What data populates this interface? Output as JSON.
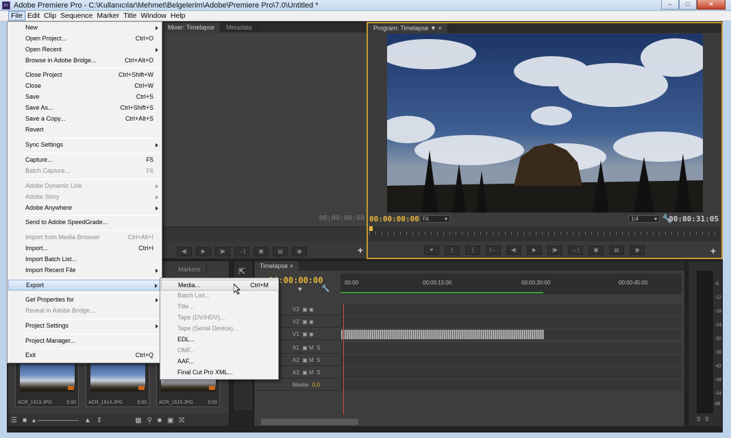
{
  "window": {
    "title": "Adobe Premiere Pro - C:\\Kullanıcılar\\Mehmet\\Belgelerim\\Adobe\\Premiere Pro\\7.0\\Untitled *",
    "app_icon": "Pr"
  },
  "menubar": [
    "File",
    "Edit",
    "Clip",
    "Sequence",
    "Marker",
    "Title",
    "Window",
    "Help"
  ],
  "file_menu": [
    {
      "label": "New",
      "shortcut": "",
      "submenu": true,
      "disabled": false
    },
    {
      "label": "Open Project...",
      "shortcut": "Ctrl+O",
      "submenu": false,
      "disabled": false
    },
    {
      "label": "Open Recent",
      "shortcut": "",
      "submenu": true,
      "disabled": false
    },
    {
      "label": "Browse in Adobe Bridge...",
      "shortcut": "Ctrl+Alt+O",
      "submenu": false,
      "disabled": false
    },
    {
      "label": "Close Project",
      "shortcut": "Ctrl+Shift+W",
      "submenu": false,
      "disabled": false
    },
    {
      "label": "Close",
      "shortcut": "Ctrl+W",
      "submenu": false,
      "disabled": false
    },
    {
      "label": "Save",
      "shortcut": "Ctrl+S",
      "submenu": false,
      "disabled": false
    },
    {
      "label": "Save As...",
      "shortcut": "Ctrl+Shift+S",
      "submenu": false,
      "disabled": false
    },
    {
      "label": "Save a Copy...",
      "shortcut": "Ctrl+Alt+S",
      "submenu": false,
      "disabled": false
    },
    {
      "label": "Revert",
      "shortcut": "",
      "submenu": false,
      "disabled": false
    },
    {
      "label": "Sync Settings",
      "shortcut": "",
      "submenu": true,
      "disabled": false
    },
    {
      "label": "Capture...",
      "shortcut": "F5",
      "submenu": false,
      "disabled": false
    },
    {
      "label": "Batch Capture...",
      "shortcut": "F6",
      "submenu": false,
      "disabled": true
    },
    {
      "label": "Adobe Dynamic Link",
      "shortcut": "",
      "submenu": true,
      "disabled": true
    },
    {
      "label": "Adobe Story",
      "shortcut": "",
      "submenu": true,
      "disabled": true
    },
    {
      "label": "Adobe Anywhere",
      "shortcut": "",
      "submenu": true,
      "disabled": false
    },
    {
      "label": "Send to Adobe SpeedGrade...",
      "shortcut": "",
      "submenu": false,
      "disabled": false
    },
    {
      "label": "Import from Media Browser",
      "shortcut": "Ctrl+Alt+I",
      "submenu": false,
      "disabled": true
    },
    {
      "label": "Import...",
      "shortcut": "Ctrl+I",
      "submenu": false,
      "disabled": false
    },
    {
      "label": "Import Batch List...",
      "shortcut": "",
      "submenu": false,
      "disabled": false
    },
    {
      "label": "Import Recent File",
      "shortcut": "",
      "submenu": true,
      "disabled": false
    },
    {
      "label": "Export",
      "shortcut": "",
      "submenu": true,
      "disabled": false,
      "highlighted": true
    },
    {
      "label": "Get Properties for",
      "shortcut": "",
      "submenu": true,
      "disabled": false
    },
    {
      "label": "Reveal in Adobe Bridge...",
      "shortcut": "",
      "submenu": false,
      "disabled": true
    },
    {
      "label": "Project Settings",
      "shortcut": "",
      "submenu": true,
      "disabled": false
    },
    {
      "label": "Project Manager...",
      "shortcut": "",
      "submenu": false,
      "disabled": false
    },
    {
      "label": "Exit",
      "shortcut": "Ctrl+Q",
      "submenu": false,
      "disabled": false
    }
  ],
  "export_submenu": [
    {
      "label": "Media...",
      "shortcut": "Ctrl+M",
      "disabled": false,
      "highlighted": true
    },
    {
      "label": "Batch List...",
      "shortcut": "",
      "disabled": true
    },
    {
      "label": "Title...",
      "shortcut": "",
      "disabled": true
    },
    {
      "label": "Tape (DV/HDV)...",
      "shortcut": "",
      "disabled": true
    },
    {
      "label": "Tape (Serial Device)...",
      "shortcut": "",
      "disabled": true
    },
    {
      "label": "EDL...",
      "shortcut": "",
      "disabled": false
    },
    {
      "label": "OMF...",
      "shortcut": "",
      "disabled": true
    },
    {
      "label": "AAF...",
      "shortcut": "",
      "disabled": false
    },
    {
      "label": "Final Cut Pro XML...",
      "shortcut": "",
      "disabled": false
    }
  ],
  "source_monitor": {
    "tabs": [
      "Mixer: Timelapse",
      "Metadata"
    ],
    "timecode": "00;00;00;00"
  },
  "program_monitor": {
    "tab": "Program: Timelapse",
    "timecode": "00:00:00:00",
    "fit": "Fit",
    "resolution": "1/4",
    "duration": "00:00:31:05"
  },
  "project_panel": {
    "tabs": [
      "Markers"
    ],
    "clips": [
      {
        "name": "ACR_1613.JPG",
        "duration": "5:00"
      },
      {
        "name": "ACR_1614.JPG",
        "duration": "5:00"
      },
      {
        "name": "ACR_1615.JPG",
        "duration": "5:00"
      }
    ]
  },
  "timeline": {
    "tab": "Timelapse",
    "timecode": "00:00:00:00",
    "ruler_labels": [
      "00:00",
      "00:00:15:00",
      "00:00:30:00",
      "00:00:45:00"
    ],
    "tracks": [
      {
        "name": "V3",
        "type": "video",
        "has_clip": false
      },
      {
        "name": "V2",
        "type": "video",
        "has_clip": false
      },
      {
        "name": "V1",
        "type": "video",
        "has_clip": true
      },
      {
        "name": "A1",
        "type": "audio",
        "has_clip": false
      },
      {
        "name": "A2",
        "type": "audio",
        "has_clip": false
      },
      {
        "name": "A3",
        "type": "audio",
        "has_clip": false
      }
    ],
    "master": {
      "label": "Master",
      "value": "0,0"
    }
  },
  "audio_meters": {
    "labels": [
      "-6",
      "-12",
      "-18",
      "-24",
      "-30",
      "-36",
      "-42",
      "-48",
      "-54",
      "dB"
    ],
    "buttons": [
      "S",
      "S"
    ]
  },
  "colors": {
    "accent_timecode": "#e8b53d",
    "program_border": "#c49a33",
    "playhead": "#e04a3a",
    "work_area": "#3ea43a"
  }
}
